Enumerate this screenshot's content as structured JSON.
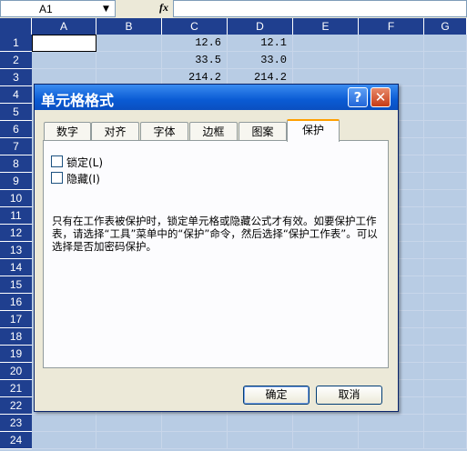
{
  "formula_bar": {
    "name_box": "A1",
    "fx_label": "fx",
    "formula": ""
  },
  "sheet": {
    "columns": [
      "A",
      "B",
      "C",
      "D",
      "E",
      "F",
      "G"
    ],
    "rows": [
      "1",
      "2",
      "3",
      "4",
      "5",
      "6",
      "7",
      "8",
      "9",
      "10",
      "11",
      "12",
      "13",
      "14",
      "15",
      "16",
      "17",
      "18",
      "19",
      "20",
      "21",
      "22",
      "23",
      "24"
    ],
    "cells": {
      "C1": "12.6",
      "D1": "12.1",
      "C2": "33.5",
      "D2": "33.0",
      "C3": "214.2",
      "D3": "214.2"
    }
  },
  "dialog": {
    "title": "单元格格式",
    "help": "?",
    "close": "✕",
    "tabs": [
      "数字",
      "对齐",
      "字体",
      "边框",
      "图案",
      "保护"
    ],
    "active_tab": "保护",
    "locked_label": "锁定(L)",
    "hidden_label": "隐藏(I)",
    "info_text": "只有在工作表被保护时，锁定单元格或隐藏公式才有效。如要保护工作表，请选择“工具”菜单中的“保护”命令，然后选择“保护工作表”。可以选择是否加密码保护。",
    "ok": "确定",
    "cancel": "取消"
  }
}
